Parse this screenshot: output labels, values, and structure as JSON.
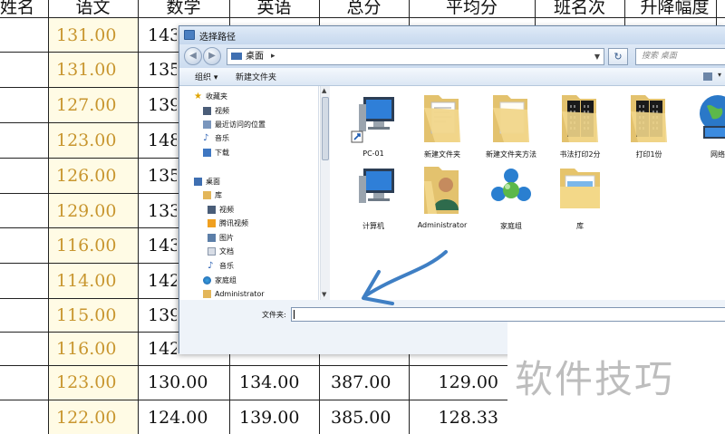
{
  "spreadsheet": {
    "headers": [
      "姓名",
      "语文",
      "数学",
      "英语",
      "总分",
      "平均分",
      "班名次",
      "升降幅度"
    ],
    "rows": [
      {
        "yuwen": "131.00",
        "shuxue": "143"
      },
      {
        "yuwen": "131.00",
        "shuxue": "135"
      },
      {
        "yuwen": "127.00",
        "shuxue": "139"
      },
      {
        "yuwen": "123.00",
        "shuxue": "148"
      },
      {
        "yuwen": "126.00",
        "shuxue": "135"
      },
      {
        "yuwen": "129.00",
        "shuxue": "133"
      },
      {
        "yuwen": "116.00",
        "shuxue": "143"
      },
      {
        "yuwen": "114.00",
        "shuxue": "142"
      },
      {
        "yuwen": "115.00",
        "shuxue": "139"
      },
      {
        "yuwen": "116.00",
        "shuxue": "142"
      },
      {
        "yuwen": "123.00",
        "shuxue": "130.00",
        "yingyu": "134.00",
        "zongfen": "387.00",
        "pingjun": "129.00"
      },
      {
        "yuwen": "122.00",
        "shuxue": "124.00",
        "yingyu": "139.00",
        "zongfen": "385.00",
        "pingjun": "128.33"
      }
    ]
  },
  "dialog": {
    "title": "选择路径",
    "address": "桌面",
    "address_arrow": "▸",
    "search_placeholder": "搜索 桌面",
    "toolbar": {
      "organize": "组织 ▾",
      "new_folder": "新建文件夹"
    },
    "nav": {
      "favorites": "收藏夹",
      "fav_items": [
        "视频",
        "最近访问的位置",
        "音乐",
        "下载"
      ],
      "desktop": "桌面",
      "library": "库",
      "lib_items": [
        "视频",
        "腾讯视频",
        "图片",
        "文档",
        "音乐"
      ],
      "homegroup": "家庭组",
      "admin": "Administrator"
    },
    "files": [
      {
        "label": "PC-01",
        "icon": "computer-shortcut-icon"
      },
      {
        "label": "新建文件夹",
        "icon": "folder-icon"
      },
      {
        "label": "新建文件夹方法",
        "icon": "folder-icon"
      },
      {
        "label": "书法打印2分",
        "icon": "folder-icon"
      },
      {
        "label": "打印1份",
        "icon": "folder-icon"
      },
      {
        "label": "网络",
        "icon": "network-globe-icon"
      },
      {
        "label": "计算机",
        "icon": "computer-icon"
      },
      {
        "label": "Administrator",
        "icon": "user-folder-icon"
      },
      {
        "label": "家庭组",
        "icon": "homegroup-icon"
      },
      {
        "label": "库",
        "icon": "library-folder-icon"
      }
    ],
    "folder_label": "文件夹:"
  },
  "watermark": "软件技巧",
  "colors": {
    "score_gold": "#c8962f",
    "arrow_blue": "#3f7fc4"
  }
}
